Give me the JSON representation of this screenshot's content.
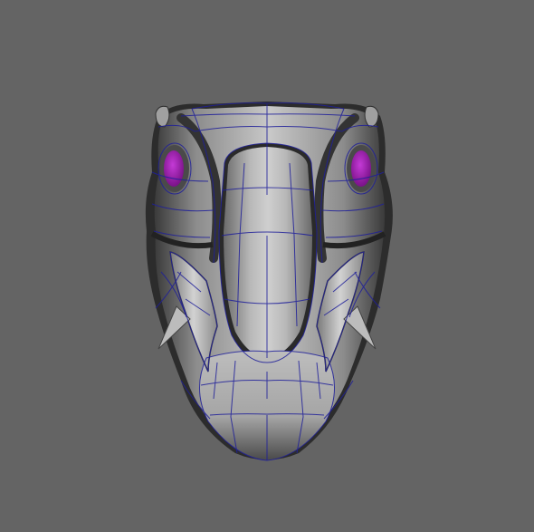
{
  "viewport": {
    "background": "#646464"
  },
  "model": {
    "subject": "creature-head",
    "view": "front",
    "display_mode": "smooth-shaded-with-wireframe",
    "colors": {
      "surface_light": "#c4c4c4",
      "surface_mid": "#9a9a9a",
      "surface_dark": "#2a2a2a",
      "wireframe": "#1f1f9a",
      "eye": "#a21fb3"
    }
  }
}
